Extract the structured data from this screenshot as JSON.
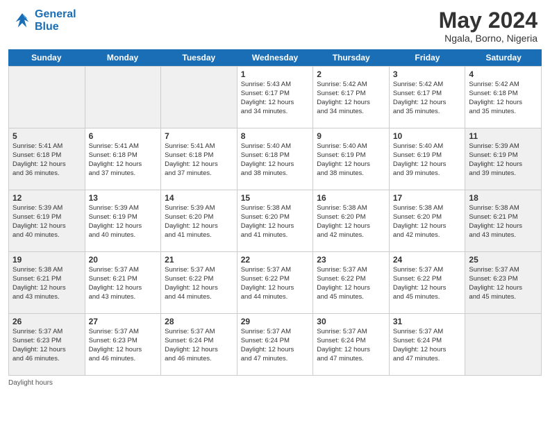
{
  "logo": {
    "line1": "General",
    "line2": "Blue"
  },
  "title": "May 2024",
  "subtitle": "Ngala, Borno, Nigeria",
  "days_of_week": [
    "Sunday",
    "Monday",
    "Tuesday",
    "Wednesday",
    "Thursday",
    "Friday",
    "Saturday"
  ],
  "weeks": [
    [
      {
        "day": "",
        "info": "",
        "shaded": true
      },
      {
        "day": "",
        "info": "",
        "shaded": true
      },
      {
        "day": "",
        "info": "",
        "shaded": true
      },
      {
        "day": "1",
        "info": "Sunrise: 5:43 AM\nSunset: 6:17 PM\nDaylight: 12 hours\nand 34 minutes.",
        "shaded": false
      },
      {
        "day": "2",
        "info": "Sunrise: 5:42 AM\nSunset: 6:17 PM\nDaylight: 12 hours\nand 34 minutes.",
        "shaded": false
      },
      {
        "day": "3",
        "info": "Sunrise: 5:42 AM\nSunset: 6:17 PM\nDaylight: 12 hours\nand 35 minutes.",
        "shaded": false
      },
      {
        "day": "4",
        "info": "Sunrise: 5:42 AM\nSunset: 6:18 PM\nDaylight: 12 hours\nand 35 minutes.",
        "shaded": false
      }
    ],
    [
      {
        "day": "5",
        "info": "Sunrise: 5:41 AM\nSunset: 6:18 PM\nDaylight: 12 hours\nand 36 minutes.",
        "shaded": true
      },
      {
        "day": "6",
        "info": "Sunrise: 5:41 AM\nSunset: 6:18 PM\nDaylight: 12 hours\nand 37 minutes.",
        "shaded": false
      },
      {
        "day": "7",
        "info": "Sunrise: 5:41 AM\nSunset: 6:18 PM\nDaylight: 12 hours\nand 37 minutes.",
        "shaded": false
      },
      {
        "day": "8",
        "info": "Sunrise: 5:40 AM\nSunset: 6:18 PM\nDaylight: 12 hours\nand 38 minutes.",
        "shaded": false
      },
      {
        "day": "9",
        "info": "Sunrise: 5:40 AM\nSunset: 6:19 PM\nDaylight: 12 hours\nand 38 minutes.",
        "shaded": false
      },
      {
        "day": "10",
        "info": "Sunrise: 5:40 AM\nSunset: 6:19 PM\nDaylight: 12 hours\nand 39 minutes.",
        "shaded": false
      },
      {
        "day": "11",
        "info": "Sunrise: 5:39 AM\nSunset: 6:19 PM\nDaylight: 12 hours\nand 39 minutes.",
        "shaded": true
      }
    ],
    [
      {
        "day": "12",
        "info": "Sunrise: 5:39 AM\nSunset: 6:19 PM\nDaylight: 12 hours\nand 40 minutes.",
        "shaded": true
      },
      {
        "day": "13",
        "info": "Sunrise: 5:39 AM\nSunset: 6:19 PM\nDaylight: 12 hours\nand 40 minutes.",
        "shaded": false
      },
      {
        "day": "14",
        "info": "Sunrise: 5:39 AM\nSunset: 6:20 PM\nDaylight: 12 hours\nand 41 minutes.",
        "shaded": false
      },
      {
        "day": "15",
        "info": "Sunrise: 5:38 AM\nSunset: 6:20 PM\nDaylight: 12 hours\nand 41 minutes.",
        "shaded": false
      },
      {
        "day": "16",
        "info": "Sunrise: 5:38 AM\nSunset: 6:20 PM\nDaylight: 12 hours\nand 42 minutes.",
        "shaded": false
      },
      {
        "day": "17",
        "info": "Sunrise: 5:38 AM\nSunset: 6:20 PM\nDaylight: 12 hours\nand 42 minutes.",
        "shaded": false
      },
      {
        "day": "18",
        "info": "Sunrise: 5:38 AM\nSunset: 6:21 PM\nDaylight: 12 hours\nand 43 minutes.",
        "shaded": true
      }
    ],
    [
      {
        "day": "19",
        "info": "Sunrise: 5:38 AM\nSunset: 6:21 PM\nDaylight: 12 hours\nand 43 minutes.",
        "shaded": true
      },
      {
        "day": "20",
        "info": "Sunrise: 5:37 AM\nSunset: 6:21 PM\nDaylight: 12 hours\nand 43 minutes.",
        "shaded": false
      },
      {
        "day": "21",
        "info": "Sunrise: 5:37 AM\nSunset: 6:22 PM\nDaylight: 12 hours\nand 44 minutes.",
        "shaded": false
      },
      {
        "day": "22",
        "info": "Sunrise: 5:37 AM\nSunset: 6:22 PM\nDaylight: 12 hours\nand 44 minutes.",
        "shaded": false
      },
      {
        "day": "23",
        "info": "Sunrise: 5:37 AM\nSunset: 6:22 PM\nDaylight: 12 hours\nand 45 minutes.",
        "shaded": false
      },
      {
        "day": "24",
        "info": "Sunrise: 5:37 AM\nSunset: 6:22 PM\nDaylight: 12 hours\nand 45 minutes.",
        "shaded": false
      },
      {
        "day": "25",
        "info": "Sunrise: 5:37 AM\nSunset: 6:23 PM\nDaylight: 12 hours\nand 45 minutes.",
        "shaded": true
      }
    ],
    [
      {
        "day": "26",
        "info": "Sunrise: 5:37 AM\nSunset: 6:23 PM\nDaylight: 12 hours\nand 46 minutes.",
        "shaded": true
      },
      {
        "day": "27",
        "info": "Sunrise: 5:37 AM\nSunset: 6:23 PM\nDaylight: 12 hours\nand 46 minutes.",
        "shaded": false
      },
      {
        "day": "28",
        "info": "Sunrise: 5:37 AM\nSunset: 6:24 PM\nDaylight: 12 hours\nand 46 minutes.",
        "shaded": false
      },
      {
        "day": "29",
        "info": "Sunrise: 5:37 AM\nSunset: 6:24 PM\nDaylight: 12 hours\nand 47 minutes.",
        "shaded": false
      },
      {
        "day": "30",
        "info": "Sunrise: 5:37 AM\nSunset: 6:24 PM\nDaylight: 12 hours\nand 47 minutes.",
        "shaded": false
      },
      {
        "day": "31",
        "info": "Sunrise: 5:37 AM\nSunset: 6:24 PM\nDaylight: 12 hours\nand 47 minutes.",
        "shaded": false
      },
      {
        "day": "",
        "info": "",
        "shaded": true
      }
    ]
  ],
  "footer_text": "Daylight hours"
}
